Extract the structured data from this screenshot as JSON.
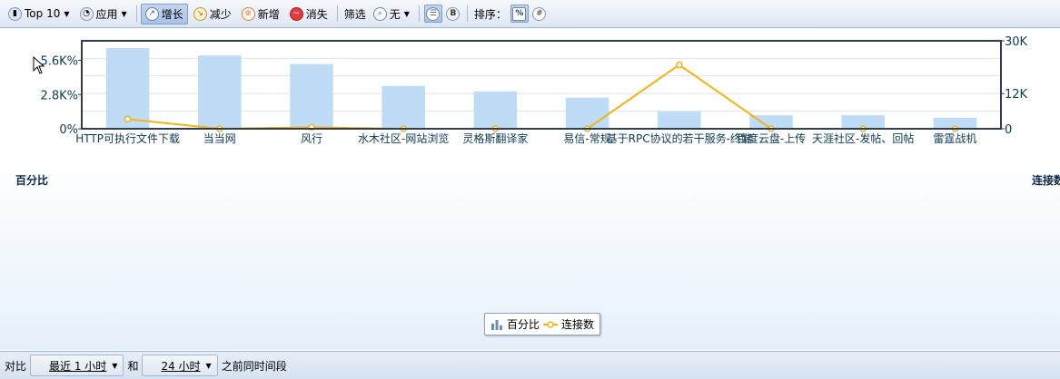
{
  "toolbar": {
    "top_label": "Top 10",
    "app_label": "应用",
    "grow_label": "增长",
    "reduce_label": "减少",
    "new_label": "新增",
    "vanish_label": "消失",
    "filter_label": "筛选",
    "filter_value": "无",
    "sort_label": "排序："
  },
  "chart_data": {
    "type": "bar",
    "categories": [
      "HTTP可执行文件下载",
      "当当网",
      "风行",
      "水木社区-网站浏览",
      "灵格斯翻译家",
      "易信-常规",
      "基于RPC协议的若干服务-终端",
      "百度云盘-上传",
      "天涯社区-发帖、回帖",
      "雷霆战机"
    ],
    "series": [
      {
        "name": "百分比",
        "axis": "left",
        "kind": "bar",
        "values": [
          6.6,
          6.0,
          5.3,
          3.5,
          3.05,
          2.55,
          1.4,
          1.1,
          1.1,
          0.9
        ]
      },
      {
        "name": "连接数",
        "axis": "right",
        "kind": "line",
        "values": [
          3300,
          0,
          500,
          0,
          0,
          0,
          21800,
          0,
          0,
          0
        ]
      }
    ],
    "left_axis": {
      "ticks": [
        "0%",
        "2.8K%",
        "5.6K%"
      ],
      "max": 7.2
    },
    "right_axis": {
      "ticks": [
        "0",
        "12K",
        "30K"
      ],
      "max": 30000
    },
    "ylabel_left": "百分比",
    "ylabel_right": "连接数",
    "colors": {
      "bar": "#bedcf6",
      "line": "#f2b418",
      "grid": "#dde4ea",
      "frame": "#2e3e4e"
    }
  },
  "legend": {
    "bar_label": "百分比",
    "line_label": "连接数"
  },
  "bottom": {
    "compare_label": "对比",
    "range1": "最近 1 小时",
    "and_label": "和",
    "range2": "24 小时",
    "suffix": "之前同时间段"
  }
}
